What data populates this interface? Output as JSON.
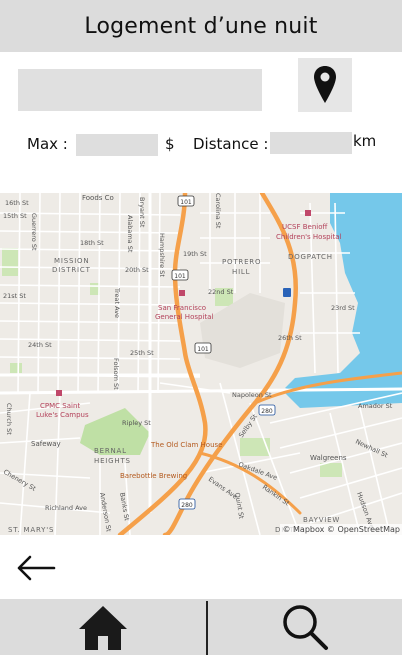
{
  "header": {
    "title": "Logement d’une nuit"
  },
  "search": {
    "value": "",
    "placeholder": ""
  },
  "location_button": {
    "icon": "map-pin-icon"
  },
  "filters": {
    "max_label": "Max :",
    "max_value": "",
    "currency": "$",
    "distance_label": "Distance :",
    "distance_value": "",
    "unit": "km"
  },
  "map": {
    "attribution": "© Mapbox © OpenStreetMap",
    "districts": [
      "MISSION",
      "DISTRICT",
      "POTRERO",
      "HILL",
      "DOGPATCH",
      "BERNAL",
      "HEIGHTS",
      "BAYVIEW",
      "DISTR",
      "ST. MARY'S"
    ],
    "pois": [
      "UCSF Benioff",
      "Children's Hospital",
      "San Francisco",
      "General Hospital",
      "CPMC Saint",
      "Luke's Campus",
      "The Old Clam House",
      "Barebottle Brewing",
      "Foods Co",
      "Safeway",
      "Walgreens"
    ],
    "streets": [
      "16th St",
      "15th St",
      "18th St",
      "19th St",
      "20th St",
      "21st St",
      "22nd St",
      "23rd St",
      "24th St",
      "25th St",
      "26th St",
      "Guerrero St",
      "Bryant St",
      "Alabama St",
      "Hampshire St",
      "Treat Ave",
      "Folsom St",
      "Carolina St",
      "Church St",
      "Chenery St",
      "Richland Ave",
      "Anderson St",
      "Banks St",
      "Ripley St",
      "Napoleon St",
      "Amador St",
      "Newhall St",
      "Oakdale Ave",
      "Quint St",
      "Selby St",
      "Rankin St",
      "Evans Ave",
      "Hudson Ave"
    ],
    "highway_shields": [
      "101",
      "101",
      "101",
      "280",
      "280"
    ]
  },
  "back_button": {
    "icon": "arrow-left-icon"
  },
  "nav": {
    "home_icon": "home-icon",
    "search_icon": "search-icon"
  },
  "colors": {
    "bar": "#dcdcdc",
    "field": "#e0e0e0",
    "highway": "#f5a04a",
    "water": "#70c7e9",
    "park": "#cde6b6"
  }
}
